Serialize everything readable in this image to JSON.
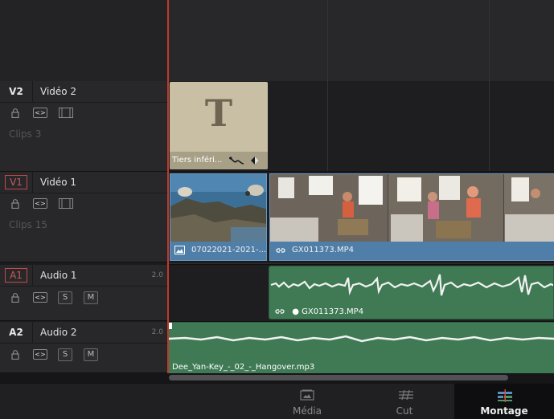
{
  "tracks": {
    "v2": {
      "id": "V2",
      "name": "Vidéo 2",
      "clips": "Clips 3"
    },
    "v1": {
      "id": "V1",
      "name": "Vidéo 1",
      "clips": "Clips 15"
    },
    "a1": {
      "id": "A1",
      "name": "Audio 1",
      "channels": "2.0",
      "solo": "S",
      "mute": "M"
    },
    "a2": {
      "id": "A2",
      "name": "Audio 2",
      "channels": "2.0",
      "solo": "S",
      "mute": "M"
    }
  },
  "timeline_clips": {
    "title_clip": {
      "glyph": "T",
      "label": "Tiers inféri..."
    },
    "photo_clip": {
      "label": "07022021-2021-..."
    },
    "video_clip": {
      "label": "GX011373.MP4"
    },
    "audio_linked": {
      "label": "● GX011373.MP4"
    },
    "music_clip": {
      "label": "Dee_Yan-Key_-_02_-_Hangover.mp3"
    }
  },
  "page_tabs": {
    "media": "Média",
    "cut": "Cut",
    "edit": "Montage"
  },
  "colors": {
    "playhead": "#c0392b",
    "video_clip": "#4f7ea8",
    "audio_clip": "#3f7a55",
    "title_clip": "#c8bfa4",
    "track_target": "#c24a4a"
  },
  "icons": [
    "lock-icon",
    "link-toggle-icon",
    "video-toggle-icon",
    "image-icon",
    "link-icon",
    "keyframe-curve-icon",
    "keyframe-diamond-icon",
    "media-page-icon",
    "cut-page-icon",
    "edit-page-icon"
  ]
}
